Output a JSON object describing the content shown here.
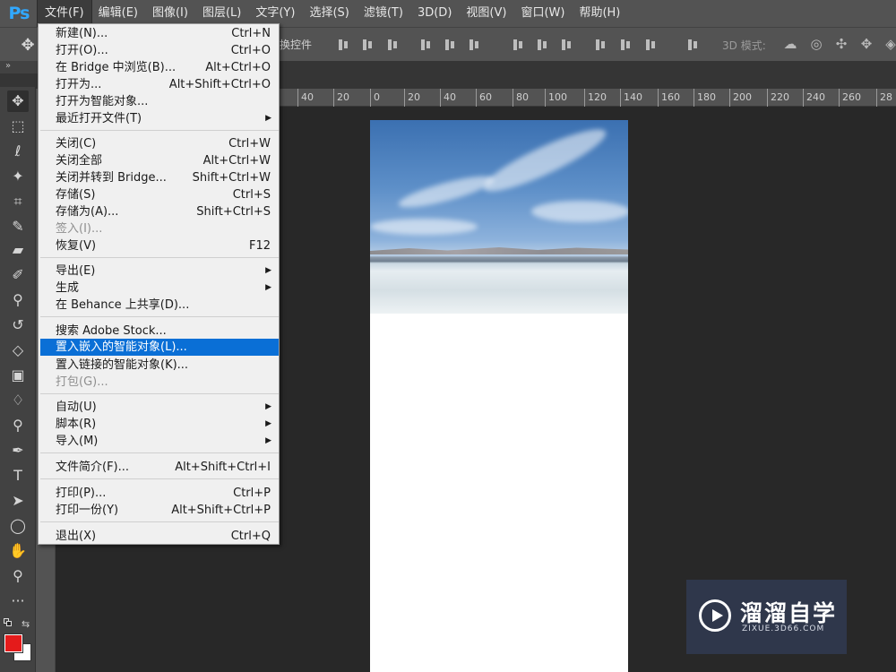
{
  "app": {
    "logo": "Ps"
  },
  "menubar": {
    "items": [
      "文件(F)",
      "编辑(E)",
      "图像(I)",
      "图层(L)",
      "文字(Y)",
      "选择(S)",
      "滤镜(T)",
      "3D(D)",
      "视图(V)",
      "窗口(W)",
      "帮助(H)"
    ]
  },
  "options_bar": {
    "transform_label": "换控件",
    "mode_3d_label": "3D 模式:"
  },
  "panel_collapse": "»",
  "ruler": {
    "ticks": [
      "40",
      "20",
      "0",
      "20",
      "40",
      "60",
      "80",
      "100",
      "120",
      "140",
      "160",
      "180",
      "200",
      "220",
      "240",
      "260",
      "28"
    ]
  },
  "file_menu": {
    "items": [
      {
        "label": "新建(N)...",
        "shortcut": "Ctrl+N"
      },
      {
        "label": "打开(O)...",
        "shortcut": "Ctrl+O"
      },
      {
        "label": "在 Bridge 中浏览(B)...",
        "shortcut": "Alt+Ctrl+O"
      },
      {
        "label": "打开为...",
        "shortcut": "Alt+Shift+Ctrl+O"
      },
      {
        "label": "打开为智能对象...",
        "shortcut": ""
      },
      {
        "label": "最近打开文件(T)",
        "shortcut": "",
        "submenu": true
      },
      {
        "label": "关闭(C)",
        "shortcut": "Ctrl+W"
      },
      {
        "label": "关闭全部",
        "shortcut": "Alt+Ctrl+W"
      },
      {
        "label": "关闭并转到 Bridge...",
        "shortcut": "Shift+Ctrl+W"
      },
      {
        "label": "存储(S)",
        "shortcut": "Ctrl+S"
      },
      {
        "label": "存储为(A)...",
        "shortcut": "Shift+Ctrl+S"
      },
      {
        "label": "签入(I)...",
        "shortcut": "",
        "disabled": true
      },
      {
        "label": "恢复(V)",
        "shortcut": "F12"
      },
      {
        "label": "导出(E)",
        "shortcut": "",
        "submenu": true
      },
      {
        "label": "生成",
        "shortcut": "",
        "submenu": true
      },
      {
        "label": "在 Behance 上共享(D)...",
        "shortcut": ""
      },
      {
        "label": "搜索 Adobe Stock...",
        "shortcut": ""
      },
      {
        "label": "置入嵌入的智能对象(L)...",
        "shortcut": "",
        "highlight": true
      },
      {
        "label": "置入链接的智能对象(K)...",
        "shortcut": ""
      },
      {
        "label": "打包(G)...",
        "shortcut": "",
        "disabled": true
      },
      {
        "label": "自动(U)",
        "shortcut": "",
        "submenu": true
      },
      {
        "label": "脚本(R)",
        "shortcut": "",
        "submenu": true
      },
      {
        "label": "导入(M)",
        "shortcut": "",
        "submenu": true
      },
      {
        "label": "文件简介(F)...",
        "shortcut": "Alt+Shift+Ctrl+I"
      },
      {
        "label": "打印(P)...",
        "shortcut": "Ctrl+P"
      },
      {
        "label": "打印一份(Y)",
        "shortcut": "Alt+Shift+Ctrl+P"
      },
      {
        "label": "退出(X)",
        "shortcut": "Ctrl+Q"
      }
    ]
  },
  "tools": [
    "move-tool",
    "marquee-tool",
    "lasso-tool",
    "magic-wand-tool",
    "crop-tool",
    "eyedropper-tool",
    "healing-brush-tool",
    "brush-tool",
    "clone-stamp-tool",
    "history-brush-tool",
    "eraser-tool",
    "gradient-tool",
    "blur-tool",
    "dodge-tool",
    "pen-tool",
    "type-tool",
    "path-selection-tool",
    "shape-tool",
    "hand-tool",
    "zoom-tool",
    "more-tools"
  ],
  "colors": {
    "foreground": "#e41b1b",
    "background": "#ffffff",
    "highlight": "#0a6fd6"
  },
  "watermark": {
    "title": "溜溜自学",
    "subtitle": "ZIXUE.3D66.COM"
  }
}
